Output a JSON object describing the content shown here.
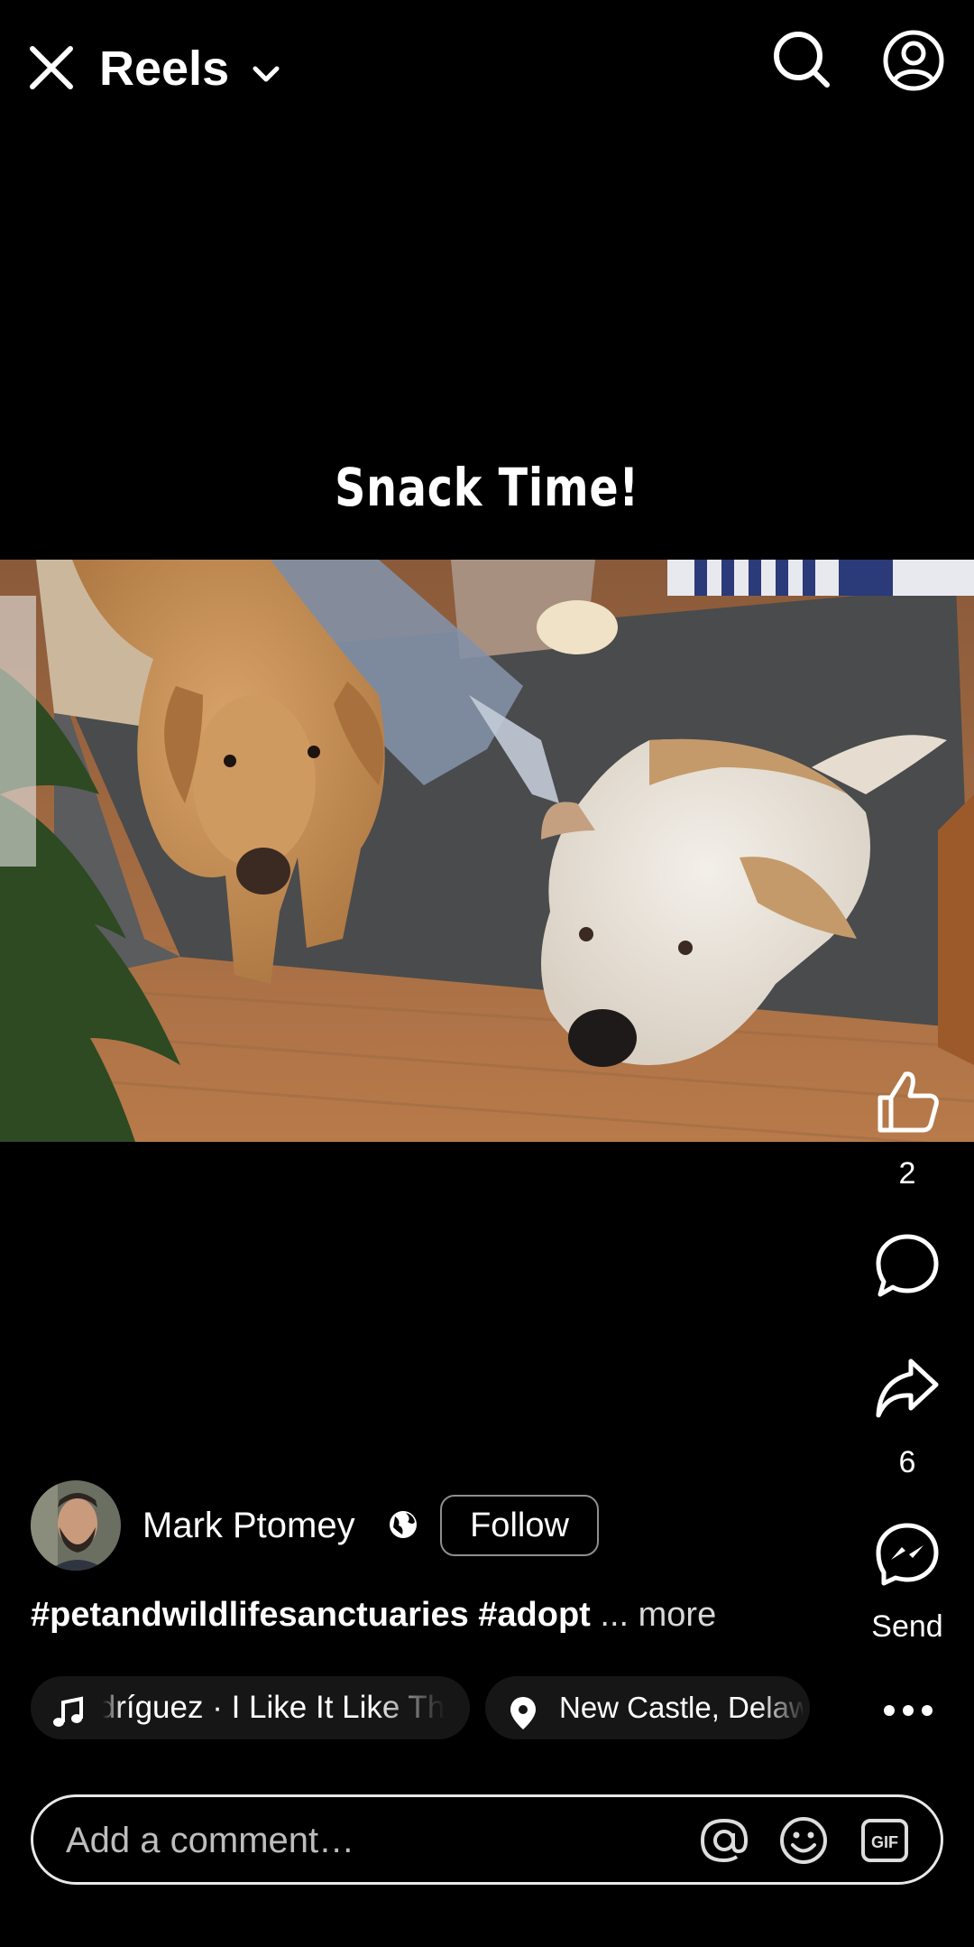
{
  "header": {
    "title": "Reels",
    "icons": [
      "close-icon",
      "chevron-down-icon",
      "search-icon",
      "profile-icon"
    ]
  },
  "video": {
    "overlay_text": "Snack Time!"
  },
  "actions": {
    "like_count": "2",
    "share_count": "6",
    "send_label": "Send",
    "icons": [
      "like-icon",
      "comment-icon",
      "share-icon",
      "messenger-icon",
      "more-icon"
    ]
  },
  "author": {
    "name": "Mark Ptomey",
    "follow_label": "Follow",
    "audience_icon": "globe-icon"
  },
  "caption": {
    "tags": "#petandwildlifesanctuaries #adopt",
    "more": "... more"
  },
  "music": {
    "text": "Rodríguez · I Like It Like That",
    "icon": "music-note-icon"
  },
  "location": {
    "text": "New Castle, Delaware",
    "icon": "location-pin-icon"
  },
  "comment": {
    "placeholder": "Add a comment…",
    "icons": [
      "mention-icon",
      "emoji-icon",
      "gif-icon"
    ]
  }
}
